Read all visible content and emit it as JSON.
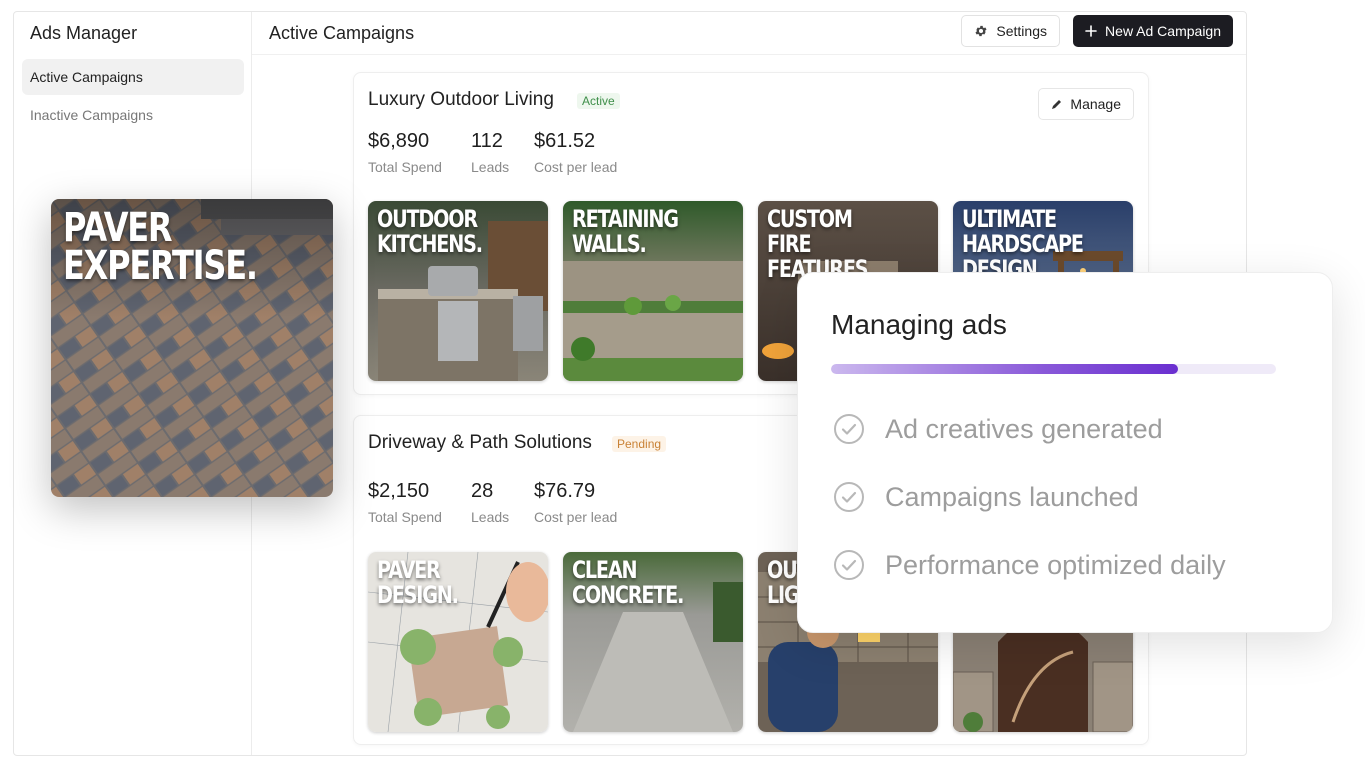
{
  "sidebar": {
    "title": "Ads Manager",
    "items": [
      {
        "label": "Active Campaigns",
        "active": true
      },
      {
        "label": "Inactive Campaigns",
        "active": false
      }
    ]
  },
  "header": {
    "title": "Active Campaigns",
    "settings_label": "Settings",
    "new_label": "New Ad Campaign"
  },
  "campaigns": [
    {
      "title": "Luxury Outdoor Living",
      "status": "Active",
      "manage_label": "Manage",
      "stats": [
        {
          "value": "$6,890",
          "label": "Total Spend"
        },
        {
          "value": "112",
          "label": "Leads"
        },
        {
          "value": "$61.52",
          "label": "Cost per lead"
        }
      ],
      "creatives": [
        "OUTDOOR\nKITCHENS.",
        "RETAINING\nWALLS.",
        "CUSTOM FIRE\nFEATURES.",
        "ULTIMATE\nHARDSCAPE\nDESIGN"
      ]
    },
    {
      "title": "Driveway & Path Solutions",
      "status": "Pending",
      "stats": [
        {
          "value": "$2,150",
          "label": "Total Spend"
        },
        {
          "value": "28",
          "label": "Leads"
        },
        {
          "value": "$76.79",
          "label": "Cost per lead"
        }
      ],
      "creatives": [
        "PAVER\nDESIGN.",
        "CLEAN\nCONCRETE.",
        "OUT\nLIG",
        ""
      ]
    }
  ],
  "floating_creative": "PAVER\nEXPERTISE.",
  "progress": {
    "title": "Managing ads",
    "percent": 78,
    "steps": [
      "Ad creatives generated",
      "Campaigns launched",
      "Performance optimized daily"
    ]
  },
  "colors": {
    "accent": "#7a3fd6",
    "primary_button": "#1c1c22",
    "active_badge": "#3f8f4a",
    "pending_badge": "#c98236"
  }
}
